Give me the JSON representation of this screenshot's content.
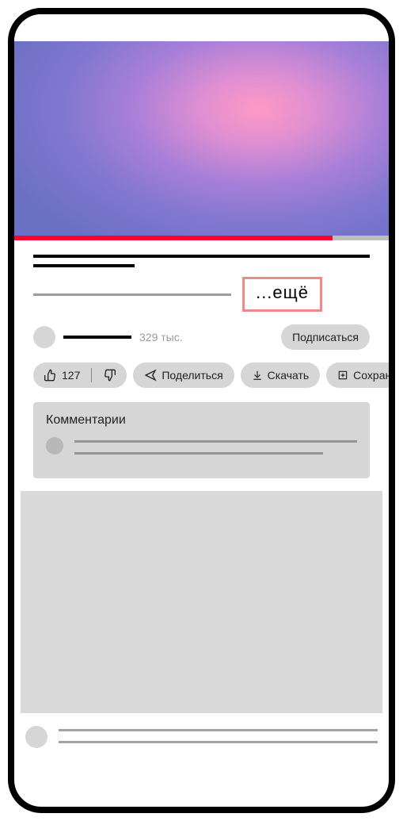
{
  "video": {
    "more_label": "...ещё",
    "progress_percent": 85
  },
  "channel": {
    "subscriber_count": "329 тыс.",
    "subscribe_label": "Подписаться"
  },
  "actions": {
    "like_count": "127",
    "share_label": "Поделиться",
    "download_label": "Скачать",
    "save_label": "Сохранить"
  },
  "comments": {
    "title": "Комментарии"
  }
}
